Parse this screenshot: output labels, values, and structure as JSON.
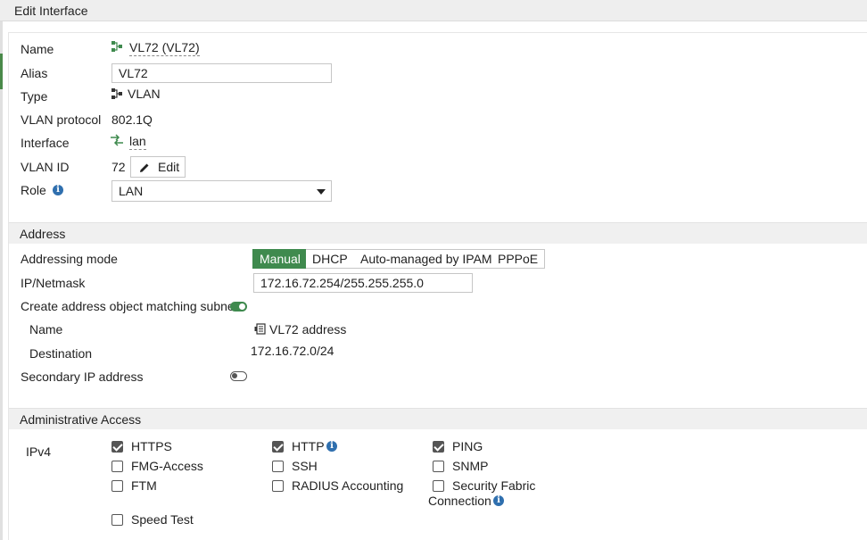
{
  "window": {
    "title": "Edit Interface"
  },
  "general": {
    "name_label": "Name",
    "name_value": "VL72 (VL72)",
    "alias_label": "Alias",
    "alias_value": "VL72",
    "type_label": "Type",
    "type_value": "VLAN",
    "vlan_protocol_label": "VLAN protocol",
    "vlan_protocol_value": "802.1Q",
    "interface_label": "Interface",
    "interface_value": "lan",
    "vlan_id_label": "VLAN ID",
    "vlan_id_value": "72",
    "edit_button": "Edit",
    "role_label": "Role",
    "role_value": "LAN"
  },
  "address": {
    "section_title": "Address",
    "addressing_mode_label": "Addressing mode",
    "modes": [
      "Manual",
      "DHCP",
      "Auto-managed by IPAM",
      "PPPoE"
    ],
    "active_mode": "Manual",
    "ip_label": "IP/Netmask",
    "ip_value": "172.16.72.254/255.255.255.0",
    "create_object_label": "Create address object matching subnet",
    "create_object_enabled": true,
    "obj_name_label": "Name",
    "obj_name_value": "VL72 address",
    "destination_label": "Destination",
    "destination_value": "172.16.72.0/24",
    "secondary_ip_label": "Secondary IP address",
    "secondary_ip_enabled": false
  },
  "admin_access": {
    "section_title": "Administrative Access",
    "ipv4_label": "IPv4",
    "options": [
      {
        "label": "HTTPS",
        "checked": true
      },
      {
        "label": "HTTP",
        "checked": true
      },
      {
        "label": "PING",
        "checked": true
      },
      {
        "label": "FMG-Access",
        "checked": false
      },
      {
        "label": "SSH",
        "checked": false
      },
      {
        "label": "SNMP",
        "checked": false
      },
      {
        "label": "FTM",
        "checked": false
      },
      {
        "label": "RADIUS Accounting",
        "checked": false
      },
      {
        "label": "Security Fabric",
        "label2": "Connection",
        "checked": false
      },
      {
        "label": "Speed Test",
        "checked": false
      }
    ]
  },
  "colors": {
    "accent_green": "#3f8a4e",
    "info_blue": "#2f6fae"
  }
}
